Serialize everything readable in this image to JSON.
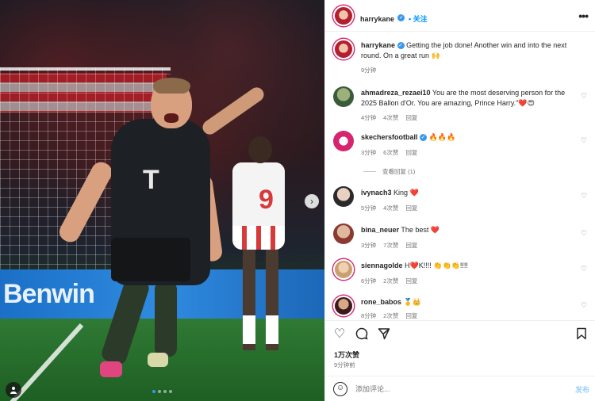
{
  "photo": {
    "adboard_text": "Benwin",
    "jersey_mark": "T",
    "opponent_number": "9",
    "next_arrow": "›",
    "carousel": {
      "total": 4,
      "active_index": 0
    },
    "tag_icon": "person-icon"
  },
  "header": {
    "username": "harrykane",
    "verified": "✓",
    "follow_label": "关注",
    "more_label": "•••"
  },
  "caption": {
    "username": "harrykane",
    "text": "Getting the job done! Another win and into the next round. On a great run 🙌",
    "time": "9分钟"
  },
  "comments": [
    {
      "username": "ahmadreza_rezaei10",
      "text": "You are the most deserving person for the 2025 Ballon d'Or. You are amazing, Prince Harry.\"❤️😍",
      "time": "4分钟",
      "likes": "4次赞",
      "reply": "回复"
    },
    {
      "username": "skechersfootball",
      "verified": true,
      "text": "🔥🔥🔥",
      "time": "3分钟",
      "likes": "6次赞",
      "reply": "回复",
      "view_replies": "查看回复 (1)"
    },
    {
      "username": "ivynach3",
      "text": "King ❤️",
      "time": "5分钟",
      "likes": "4次赞",
      "reply": "回复"
    },
    {
      "username": "bina_neuer",
      "text": "The best ❤️",
      "time": "3分钟",
      "likes": "7次赞",
      "reply": "回复"
    },
    {
      "username": "siennagolde",
      "text": "H❤️K!!!! 👏👏👏!!!!",
      "time": "6分钟",
      "likes": "2次赞",
      "reply": "回复"
    },
    {
      "username": "rone_babos",
      "text": "🥇👑",
      "time": "8分钟",
      "likes": "2次赞",
      "reply": "回复"
    }
  ],
  "actions": {
    "like_icon": "♡",
    "comment_icon": "◯",
    "share_icon": "➤",
    "save_icon": "⌑",
    "likes_count": "1万次赞",
    "posted_ago": "9分钟前"
  },
  "composer": {
    "emoji_icon": "☺",
    "placeholder": "添加评论...",
    "post_label": "发布"
  },
  "colors": {
    "link_blue": "#0095f6",
    "verified_blue": "#3897f0",
    "muted": "#737373"
  }
}
